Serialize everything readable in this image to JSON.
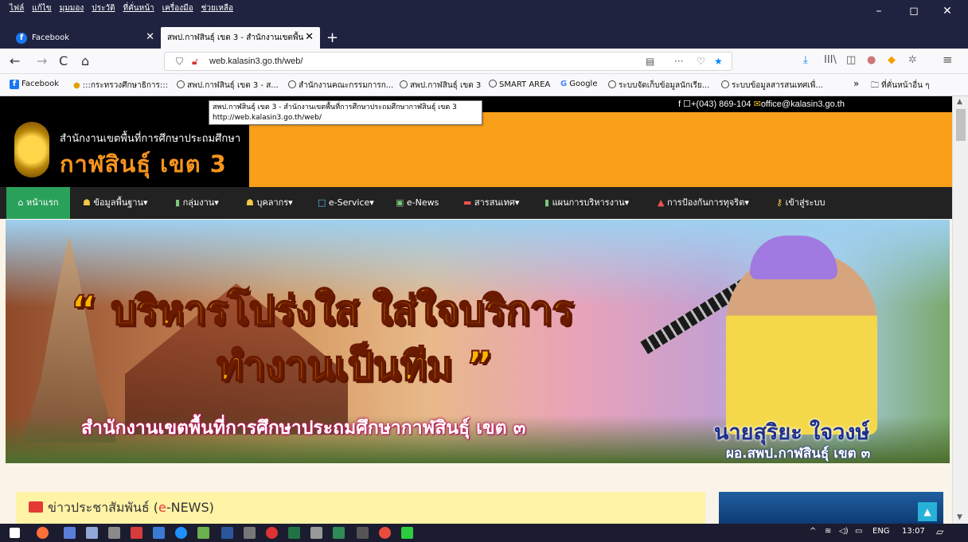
{
  "menubar": {
    "items": [
      "ไฟล์",
      "แก้ไข",
      "มุมมอง",
      "ประวัติ",
      "ที่คั่นหน้า",
      "เครื่องมือ",
      "ช่วยเหลือ"
    ],
    "minimize": "–",
    "maximize": "◻",
    "close": "✕"
  },
  "tabs": {
    "inactive_label": "Facebook",
    "active_label": "สพป.กาฬสินธุ์ เขต 3 - สำนักงานเขตพื้น",
    "close": "✕",
    "new_tab": "+"
  },
  "navbar": {
    "back": "←",
    "forward": "→",
    "reload": "C",
    "home": "⌂",
    "url": "web.kalasin3.go.th/web/",
    "more": "···",
    "download": "⤓",
    "library": "III\\",
    "menu": "≡"
  },
  "bookmarks": [
    "Facebook",
    ":::กระทรวงศึกษาธิการ:::",
    "สพป.กาฬสินธุ์ เขต 3 - ส...",
    "สำนักงานคณะกรรมการก...",
    "สพป.กาฬสินธุ์ เขต 3",
    "SMART AREA",
    "Google",
    "ระบบจัดเก็บข้อมูลนักเรีย...",
    "ระบบข้อมูลสารสนเทศเพื่...",
    "ที่คั่นหน้าอื่น ๆ"
  ],
  "bookmarks_overflow": "»",
  "site": {
    "contact_phone": "+(043) 869-104",
    "contact_email": "office@kalasin3.go.th",
    "header_subtitle": "สำนักงานเขตพื้นที่การศึกษาประถมศึกษา",
    "header_title": "กาฬสินธุ์ เขต 3",
    "menu": [
      "หน้าแรก",
      "ข้อมูลพื้นฐาน▾",
      "กลุ่มงาน▾",
      "บุคลากร▾",
      "e-Service▾",
      "e-News",
      "สารสนเทศ▾",
      "แผนการบริหารงาน▾",
      "การป้องกันการทุจริต▾",
      "เข้าสู่ระบบ"
    ],
    "banner": {
      "slogan_line1": "“ บริหารโปร่งใส ใส่ใจบริการ",
      "slogan_line2": "ทำงานเป็นทีม ”",
      "office": "สำนักงานเขตพื้นที่การศึกษาประถมศึกษากาฬสินธุ์ เขต ๓",
      "person_name": "นายสุริยะ ใจวงษ์",
      "person_role": "ผอ.สพป.กาฬสินธุ์ เขต ๓"
    },
    "news_prefix": "ข่าวประชาสัมพันธ์ (",
    "news_e": "e",
    "news_suffix": "-NEWS)",
    "to_top": "▲"
  },
  "tooltip": {
    "line1": "สพป.กาฬสินธุ์ เขต 3 - สำนักงานเขตพื้นที่การศึกษาประถมศึกษากาฬสินธุ์ เขต 3",
    "line2": "http://web.kalasin3.go.th/web/"
  },
  "taskbar": {
    "tray_arrow": "^",
    "lang": "ENG",
    "time": "13:07"
  },
  "colors": {
    "header_orange": "#f9a01b",
    "menu_bg": "#222222",
    "home_green": "#2aa15a",
    "news_yellow": "#fff3a6"
  }
}
